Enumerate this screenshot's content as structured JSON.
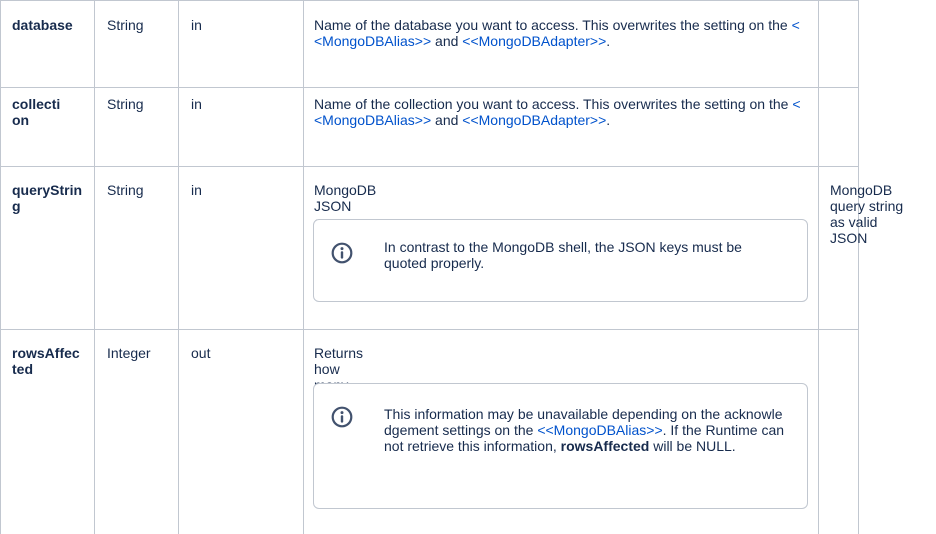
{
  "rows": [
    {
      "name": "database",
      "type": "String",
      "direction": "in",
      "desc": {
        "text1": "Name of the database you want to access. This overwrites the setting on the ",
        "link1": "<<MongoDBAlias>>",
        "mid": " and ",
        "link2": "<<MongoDBAdapter>>",
        "end": "."
      },
      "extra": ""
    },
    {
      "name": "collection",
      "type": "String",
      "direction": "in",
      "desc": {
        "text1": "Name of the collection you want to access. This overwrites the setting on the ",
        "link1": "<<MongoDBAlias>>",
        "mid": " and ",
        "link2": "<<MongoDBAdapter>>",
        "end": "."
      },
      "extra": ""
    },
    {
      "name": "queryString",
      "type": "String",
      "direction": "in",
      "desc": {
        "text1": "MongoDB JSON query string."
      },
      "info": "In contrast to the MongoDB shell, the JSON keys must be quoted properly.",
      "extra": "MongoDB query string as valid JSON"
    },
    {
      "name": "rowsAffected",
      "type": "Integer",
      "direction": "out",
      "desc": {
        "text1": "Returns how many rows have been affected by the action."
      },
      "info": {
        "pre": "This information may be unavailable depending on the acknowledgement settings on the ",
        "link": "<<MongoDBAlias>>",
        "mid": ". If the Runtime cannot retrieve this information, ",
        "bold": "rowsAffected",
        "end": " will be NULL."
      },
      "extra": ""
    }
  ],
  "colors": {
    "border": "#c1c7d0",
    "link": "#0052cc",
    "text": "#172b4d",
    "icon": "#42526e"
  }
}
